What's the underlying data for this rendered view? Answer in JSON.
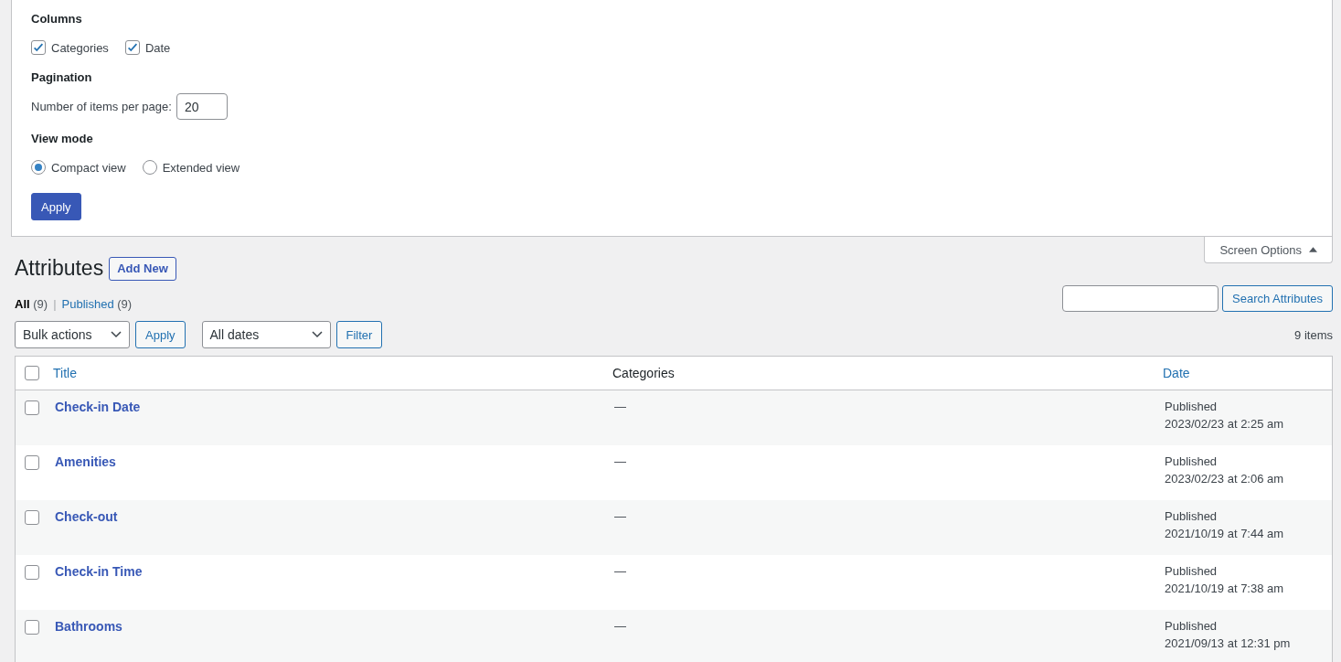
{
  "screen_options": {
    "sections": [
      {
        "kind": "checkboxes",
        "heading": "Columns",
        "items": [
          {
            "label": "Categories",
            "checked": true
          },
          {
            "label": "Date",
            "checked": true
          }
        ]
      },
      {
        "kind": "number",
        "heading": "Pagination",
        "label": "Number of items per page:",
        "value": "20"
      },
      {
        "kind": "radios",
        "heading": "View mode",
        "items": [
          {
            "label": "Compact view",
            "selected": true
          },
          {
            "label": "Extended view",
            "selected": false
          }
        ]
      }
    ],
    "apply_button": "Apply",
    "toggle": {
      "label": "Screen Options",
      "expanded": true
    }
  },
  "page": {
    "title": "Attributes",
    "add_new": "Add New",
    "view_separator": "|",
    "views": [
      {
        "label": "All",
        "count": "(9)",
        "selected": true
      },
      {
        "label": "Published",
        "count": "(9)",
        "selected": false
      }
    ],
    "search_button": "Search Attributes",
    "bulk_actions": "Bulk actions",
    "bulk_apply": "Apply",
    "date_filter": "All dates",
    "filter_button": "Filter",
    "items_count": "9 items"
  },
  "table": {
    "select_all_checked": false,
    "columns": [
      {
        "label": "Title",
        "sortable": true
      },
      {
        "label": "Categories",
        "sortable": false
      },
      {
        "label": "Date",
        "sortable": true
      }
    ],
    "rows": [
      {
        "title": "Check-in Date",
        "categories": "—",
        "status": "Published",
        "date": "2023/02/23 at 2:25 am",
        "checked": false
      },
      {
        "title": "Amenities",
        "categories": "—",
        "status": "Published",
        "date": "2023/02/23 at 2:06 am",
        "checked": false
      },
      {
        "title": "Check-out",
        "categories": "—",
        "status": "Published",
        "date": "2021/10/19 at 7:44 am",
        "checked": false
      },
      {
        "title": "Check-in Time",
        "categories": "—",
        "status": "Published",
        "date": "2021/10/19 at 7:38 am",
        "checked": false
      },
      {
        "title": "Bathrooms",
        "categories": "—",
        "status": "Published",
        "date": "2021/09/13 at 12:31 pm",
        "checked": false
      }
    ]
  }
}
